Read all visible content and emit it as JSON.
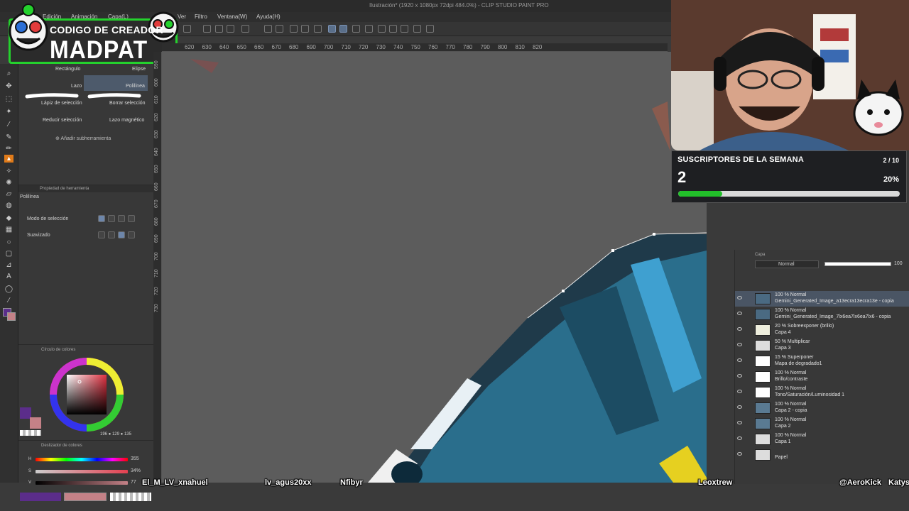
{
  "window": {
    "title": "Ilustración* (1920 x 1080px 72dpi 484.0%) - CLIP STUDIO PAINT PRO"
  },
  "menu": {
    "items": [
      "Edición",
      "Animación",
      "Capa(L)",
      "Ver",
      "Filtro",
      "Ventana(W)",
      "Ayuda(H)"
    ]
  },
  "creator_badge": {
    "line1": "CODIGO DE CREADOR",
    "line2": "MADPAT"
  },
  "subtools": {
    "rect": "Rectángulo",
    "ellipse": "Elipse",
    "lasso": "Lazo",
    "polyline": "Polilínea",
    "pencil": "Lápiz de selección",
    "erase": "Borrar selección",
    "shrink": "Reducir selección",
    "magnetic": "Lazo magnético",
    "add": "Añadir subherramienta"
  },
  "tool_property": {
    "header": "Propiedad de herramienta",
    "tool_name": "Polilínea",
    "selection_mode": "Modo de selección",
    "smoothing": "Suavizado"
  },
  "color_wheel": {
    "header": "Círculo de colores",
    "rgb": "196 ● 129 ● 135"
  },
  "color_sliders": {
    "header": "Deslizador de colores",
    "h_label": "H",
    "h_value": "355",
    "s_label": "S",
    "s_value": "34%",
    "v_label": "V",
    "v_value": "77"
  },
  "ruler_top": [
    "620",
    "630",
    "640",
    "650",
    "660",
    "670",
    "680",
    "690",
    "700",
    "710",
    "720",
    "730",
    "740",
    "750",
    "760",
    "770",
    "780",
    "790",
    "800",
    "810",
    "820"
  ],
  "ruler_left": [
    "590",
    "600",
    "610",
    "620",
    "630",
    "640",
    "650",
    "660",
    "670",
    "680",
    "690",
    "700",
    "710",
    "720",
    "730"
  ],
  "subscriber_widget": {
    "title": "SUSCRIPTORES DE LA SEMANA",
    "count": "2",
    "goal": "2 / 10",
    "percent_label": "20%",
    "progress": 0.2
  },
  "layers": {
    "header": "Capa",
    "blend_mode": "Normal",
    "opacity": "100",
    "items": [
      {
        "line1": "100 % Normal",
        "line2": "Gemini_Generated_Image_a13ecra13ecra13e - copia"
      },
      {
        "line1": "100 % Normal",
        "line2": "Gemini_Generated_Image_7lx6ea7lx6ea7lx6 - copia"
      },
      {
        "line1": "20 % Sobreexponer (brillo)",
        "line2": "Capa 4"
      },
      {
        "line1": "50 % Multiplicar",
        "line2": "Capa 3"
      },
      {
        "line1": "15 % Superponer",
        "line2": "Mapa de degradado1"
      },
      {
        "line1": "100 % Normal",
        "line2": "Brillo/contraste"
      },
      {
        "line1": "100 % Normal",
        "line2": "Tono/Saturación/Luminosidad 1"
      },
      {
        "line1": "100 % Normal",
        "line2": "Capa 2 - copia"
      },
      {
        "line1": "100 % Normal",
        "line2": "Capa 2"
      },
      {
        "line1": "100 % Normal",
        "line2": "Capa 1"
      },
      {
        "line1": "",
        "line2": "Papel"
      }
    ]
  },
  "viewers": [
    "El_M_LV_xnahuel",
    "lv_agus20xx",
    "Nfibyr",
    "Leoxtrew",
    "@AeroKick",
    "Katys"
  ],
  "colors": {
    "accent_green": "#24d12d",
    "progress_green": "#22c02a",
    "active_tool": "#e07b1a",
    "main_color": "#5b2d8a",
    "sub_color": "#c48187"
  }
}
